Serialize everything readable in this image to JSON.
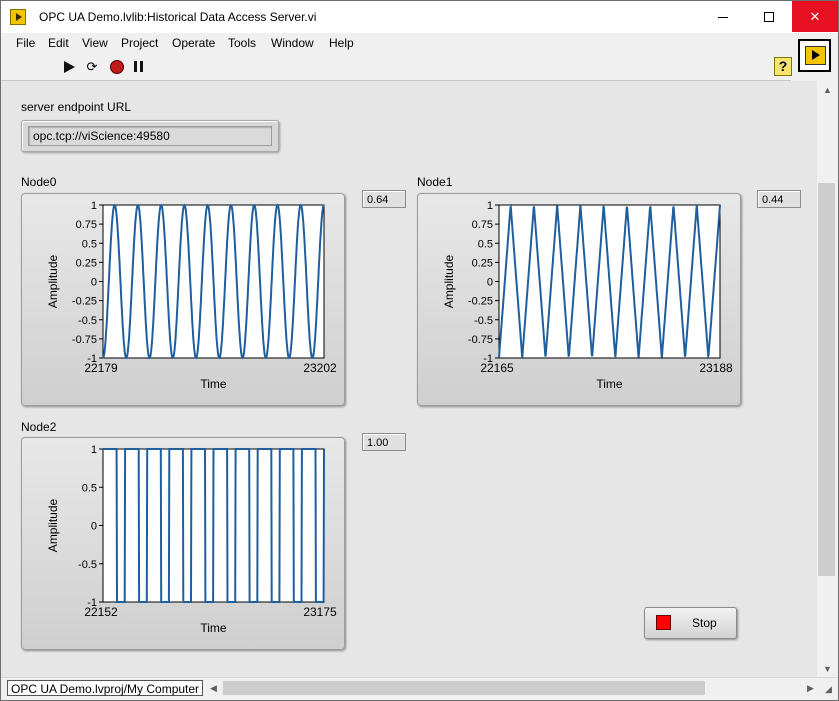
{
  "window": {
    "title": "OPC UA Demo.lvlib:Historical Data Access Server.vi",
    "min_glyph": "",
    "max_glyph": "",
    "close_glyph": "✕"
  },
  "menu": [
    "File",
    "Edit",
    "View",
    "Project",
    "Operate",
    "Tools",
    "Window",
    "Help"
  ],
  "toolbar": {
    "icons": [
      "run-arrow-icon",
      "run-continuously-icon",
      "abort-execution-icon",
      "pause-icon"
    ],
    "help_glyph": "?"
  },
  "panel": {
    "server_label": "server endpoint URL",
    "server_url": "opc.tcp://viScience:49580",
    "stop_label": "Stop"
  },
  "charts": [
    {
      "label": "Node0",
      "value": "0.64",
      "xlabel": "Time",
      "ylabel": "Amplitude",
      "xmin": "22179",
      "xmax": "23202"
    },
    {
      "label": "Node1",
      "value": "0.44",
      "xlabel": "Time",
      "ylabel": "Amplitude",
      "xmin": "22165",
      "xmax": "23188"
    },
    {
      "label": "Node2",
      "value": "1.00",
      "xlabel": "Time",
      "ylabel": "Amplitude",
      "xmin": "22152",
      "xmax": "23175"
    }
  ],
  "chart_data": [
    {
      "type": "line",
      "title": "Node0",
      "xlabel": "Time",
      "ylabel": "Amplitude",
      "xlim": [
        22179,
        23202
      ],
      "ylim": [
        -1,
        1
      ],
      "yticks": [
        "1",
        "0.75",
        "0.5",
        "0.25",
        "0",
        "-0.25",
        "-0.5",
        "-0.75",
        "-1"
      ],
      "waveform": "sine",
      "cycles": 9.5,
      "last_value": 0.64,
      "series": [
        {
          "color": "#1f5f9e"
        }
      ]
    },
    {
      "type": "line",
      "title": "Node1",
      "xlabel": "Time",
      "ylabel": "Amplitude",
      "xlim": [
        22165,
        23188
      ],
      "ylim": [
        -1,
        1
      ],
      "yticks": [
        "1",
        "0.75",
        "0.5",
        "0.25",
        "0",
        "-0.25",
        "-0.5",
        "-0.75",
        "-1"
      ],
      "waveform": "triangle",
      "cycles": 9.5,
      "last_value": 0.44,
      "series": [
        {
          "color": "#1f5f9e"
        }
      ]
    },
    {
      "type": "line",
      "title": "Node2",
      "xlabel": "Time",
      "ylabel": "Amplitude",
      "xlim": [
        22152,
        23175
      ],
      "ylim": [
        -1,
        1
      ],
      "yticks": [
        "1",
        "0.5",
        "0",
        "-0.5",
        "-1"
      ],
      "waveform": "square",
      "cycles": 10,
      "last_value": 1.0,
      "series": [
        {
          "color": "#1f5f9e"
        }
      ]
    }
  ],
  "statusbar": {
    "context": "OPC UA Demo.lvproj/My Computer"
  }
}
